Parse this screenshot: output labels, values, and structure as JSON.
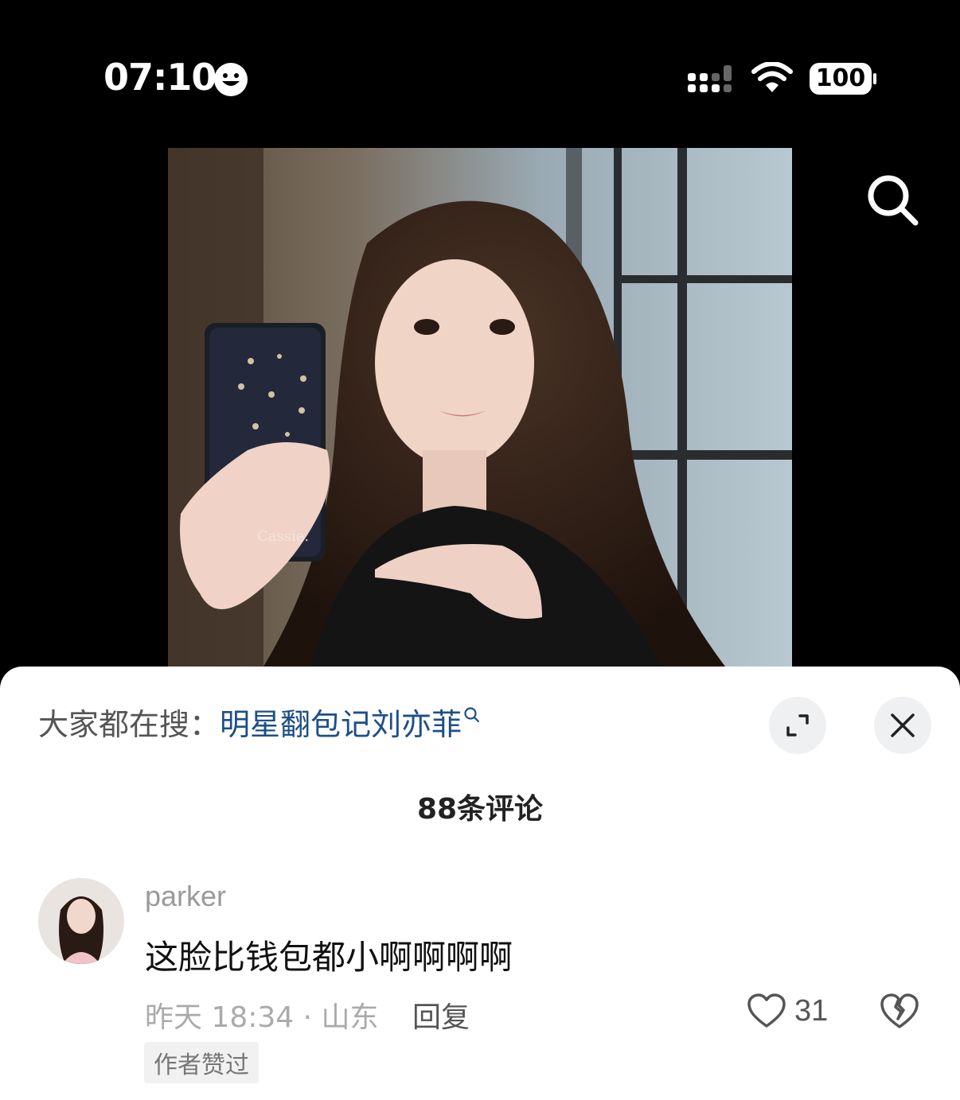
{
  "status_bar": {
    "time": "07:10",
    "battery": "100",
    "icons": [
      "smiley-icon",
      "signal-icon",
      "wifi-icon",
      "battery-icon"
    ]
  },
  "video": {
    "watermark": "Cassie."
  },
  "sheet": {
    "trending_prefix": "大家都在搜：",
    "trending_query": "明星翻包记刘亦菲",
    "comment_count_label": "88条评论"
  },
  "comments": [
    {
      "username": "parker",
      "text": "这脸比钱包都小啊啊啊啊",
      "meta": "昨天 18:34 · 山东",
      "reply_label": "回复",
      "likes": "31",
      "badge": "作者赞过"
    }
  ],
  "colors": {
    "link": "#1d4f86",
    "sheet_bg": "#ffffff",
    "page_bg": "#000000"
  }
}
